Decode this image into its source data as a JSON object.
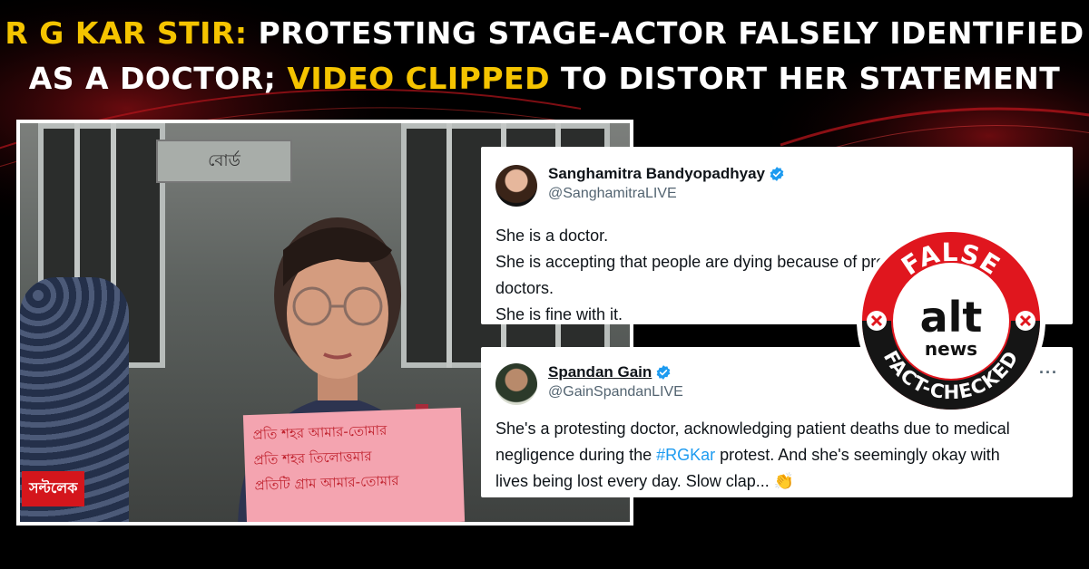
{
  "headline": {
    "line1_highlight": "R G KAR STIR:",
    "line1_rest": " PROTESTING STAGE-ACTOR FALSELY IDENTIFIED",
    "line2_start": "AS A DOCTOR; ",
    "line2_highlight": "VIDEO CLIPPED",
    "line2_rest": " TO DISTORT HER STATEMENT"
  },
  "video": {
    "channel_badge": "সল্টলেক",
    "sign_text": "বোর্ড",
    "placard_lines": [
      "প্রতি শহর আমার-তোমার",
      "প্রতি শহর তিলোত্তমার",
      "প্রতিটি গ্রাম আমার-তোমার"
    ]
  },
  "tweets": [
    {
      "name": "Sanghamitra Bandyopadhyay",
      "handle": "@SanghamitraLIVE",
      "lines": [
        "She is a doctor.",
        "She is accepting that people are dying because of protesting junior",
        "doctors.",
        "She is fine with it."
      ]
    },
    {
      "name": "Spandan Gain",
      "handle": "@GainSpandanLIVE",
      "more": "···",
      "line1": "She's a protesting doctor, acknowledging patient deaths due to medical",
      "line2_before": "negligence during the ",
      "line2_hashtag": "#RGKar",
      "line2_after": " protest. And she's seemingly okay with",
      "line3": "lives being lost every day. Slow clap... 👏"
    }
  ],
  "stamp": {
    "verdict": "FALSE",
    "brand_top": "alt",
    "brand_bottom": "news",
    "label": "FACT-CHECKED"
  },
  "colors": {
    "highlight": "#f5c400",
    "stamp_red": "#e0161e",
    "verified_blue": "#1d9bf0",
    "hashtag_blue": "#1d9bf0"
  }
}
